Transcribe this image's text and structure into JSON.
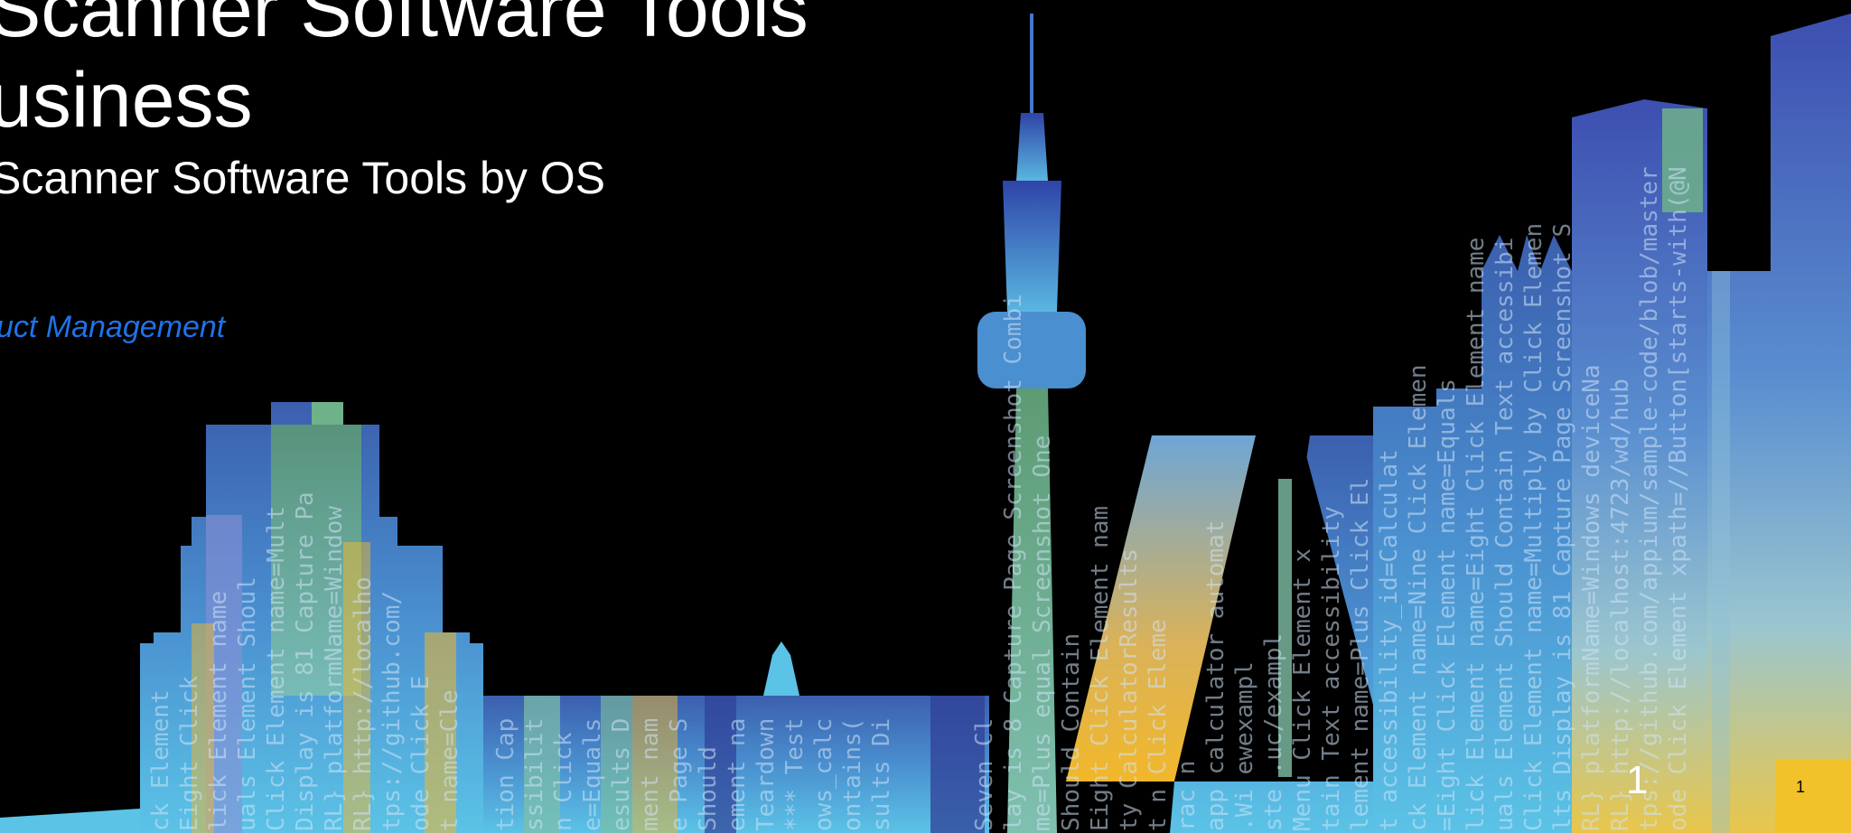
{
  "slide": {
    "title_line1": "Scanner Software Tools",
    "title_line2": "usiness",
    "subtitle": "Scanner Software Tools by OS",
    "department": "uct Management",
    "page_number": "1",
    "page_number_small": "1"
  },
  "skyline_code": [
    "ck Element",
    "Eight Click",
    "lick Element name",
    "uals Element Shoul",
    "Click Element name=Mult",
    "Display is 81 Capture Pa",
    "RL} platformName=Window",
    "RL} http://localho",
    "tps://github.com/",
    "ode Click E",
    "t name=Cle",
    "tion Cap",
    "ssibilit",
    "n Click",
    "e=Equals",
    "esults D",
    "ment nam",
    "e Page S",
    "Should",
    "ement na",
    "Teardown",
    "*** Test",
    "ows_calc",
    "ontains(",
    "sults Di",
    "Seven Cl",
    "lay is 8 Capture Page Screenshot Combi",
    "me=Plus equal Screenshot One",
    "Should Contain",
    "Eight Click Element nam",
    "ty CalculatorResults",
    "t n Click Eleme",
    "rac n",
    "app calculator automat",
    ".Wi ewexampl",
    "ste .uc/exampl",
    "Menu Click Element x",
    "tain Text accessibility",
    "lement name=Plus Click El",
    "t accessibility_id=Calculat",
    "ck Element name=Nine Click Elemen",
    "=Eight Click Element name=Equals",
    "lick Element name=Eight Click Element name",
    "uals Element Should Contain Text accessibi",
    "Click Element name=Multiply by Click Elemen",
    "lts Display is 81 Capture Page Screenshot S",
    "RL} platformName=Windows deviceNa",
    "RL} http://localhost:4723/wd/hub",
    "tps://github.com/appium/sample-code/blob/master",
    "ode Click Element xpath=//Button[starts-with(@N"
  ]
}
